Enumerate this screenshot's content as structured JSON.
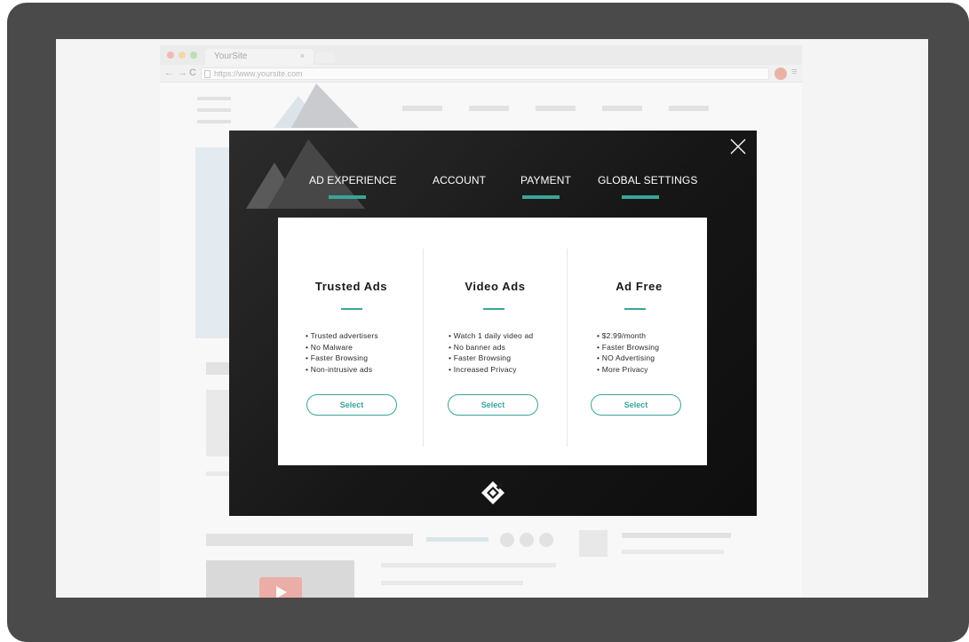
{
  "browser": {
    "tab_title": "YourSite",
    "tab_close": "×",
    "url": "https://www.yoursite.com",
    "nav_back": "←",
    "nav_forward": "→",
    "nav_reload": "C",
    "menu_icon": "≡"
  },
  "modal": {
    "tabs": [
      {
        "label": "AD EXPERIENCE",
        "active": true
      },
      {
        "label": "ACCOUNT",
        "active": false
      },
      {
        "label": "PAYMENT",
        "active": true
      },
      {
        "label": "GLOBAL SETTINGS",
        "active": true
      }
    ],
    "plans": [
      {
        "title": "Trusted Ads",
        "features": [
          "• Trusted advertisers",
          "• No Malware",
          "• Faster Browsing",
          "• Non-intrusive ads"
        ],
        "button": "Select"
      },
      {
        "title": "Video Ads",
        "features": [
          "• Watch 1 daily video ad",
          "• No banner ads",
          "• Faster Browsing",
          "• Increased Privacy"
        ],
        "button": "Select"
      },
      {
        "title": "Ad Free",
        "features": [
          "• $2.99/month",
          "• Faster Browsing",
          "• NO Advertising",
          "• More Privacy"
        ],
        "button": "Select"
      }
    ]
  },
  "colors": {
    "accent": "#3aa597",
    "frame": "#4a4a4a",
    "modal_bg": "#161616"
  }
}
